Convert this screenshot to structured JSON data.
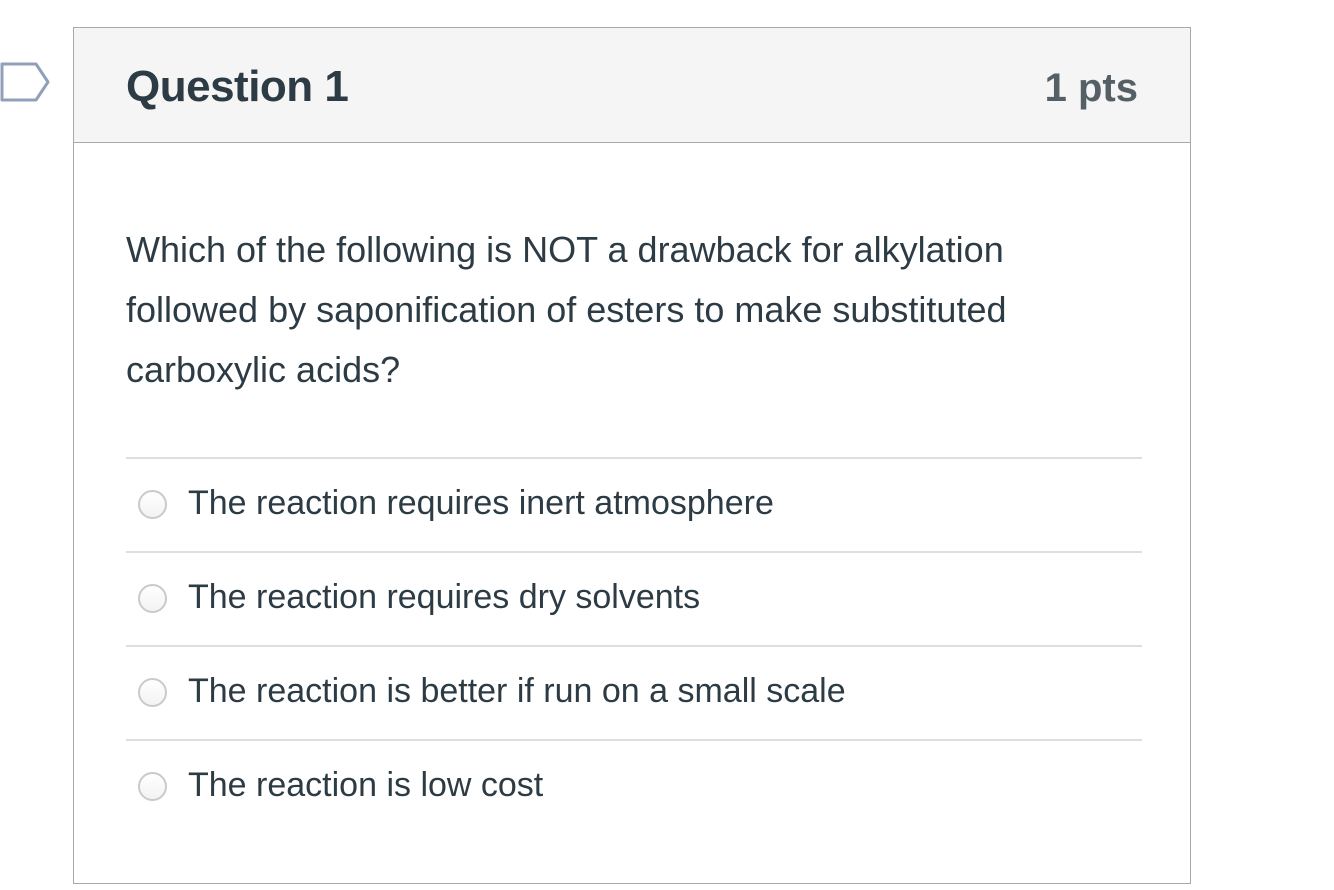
{
  "question": {
    "title": "Question 1",
    "points": "1 pts",
    "text": "Which of the following is NOT a drawback for alkylation followed by saponification of esters to make substituted carboxylic acids?",
    "answers": [
      {
        "label": "The reaction requires inert atmosphere"
      },
      {
        "label": "The reaction requires dry solvents"
      },
      {
        "label": "The reaction is better if run on a small scale"
      },
      {
        "label": "The reaction is low cost"
      }
    ]
  },
  "icons": {
    "flag": "flag-question-icon",
    "radio": "radio-unchecked"
  },
  "colors": {
    "text": "#2d3b45",
    "points": "#555f66",
    "header_bg": "#f5f5f5",
    "border": "#a9a9a9",
    "flag_stroke": "#8fa0b8"
  }
}
